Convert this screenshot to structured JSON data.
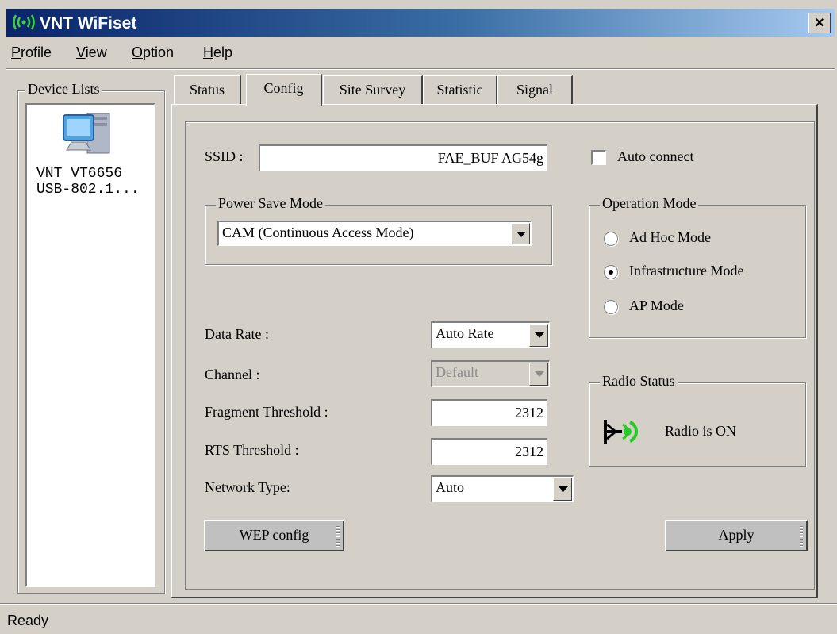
{
  "window": {
    "title": "VNT WiFiset",
    "close_glyph": "×"
  },
  "menu": {
    "items": [
      {
        "first": "P",
        "rest": "rofile"
      },
      {
        "first": "V",
        "rest": "iew"
      },
      {
        "first": "O",
        "rest": "ption"
      },
      {
        "first": "H",
        "rest": "elp"
      }
    ]
  },
  "device_list": {
    "legend": "Device Lists",
    "device_line1": "VNT VT6656",
    "device_line2": "USB-802.1..."
  },
  "tabs": [
    "Status",
    "Config",
    "Site Survey",
    "Statistic",
    "Signal"
  ],
  "active_tab": "Config",
  "config": {
    "ssid_label": "SSID :",
    "ssid_value": "FAE_BUF AG54g",
    "auto_connect_label": "Auto connect",
    "auto_connect_checked": false,
    "power_save": {
      "legend": "Power Save Mode",
      "selected": "CAM (Continuous Access Mode)"
    },
    "operation_mode": {
      "legend": "Operation Mode",
      "options": [
        "Ad Hoc Mode",
        "Infrastructure Mode",
        "AP Mode"
      ],
      "selected": "Infrastructure Mode"
    },
    "data_rate": {
      "label": "Data Rate :",
      "value": "Auto Rate"
    },
    "channel": {
      "label": "Channel :",
      "value": "Default",
      "disabled": true
    },
    "fragment_threshold": {
      "label": "Fragment Threshold :",
      "value": "2312"
    },
    "rts_threshold": {
      "label": "RTS Threshold :",
      "value": "2312"
    },
    "network_type": {
      "label": "Network Type:",
      "value": "Auto"
    },
    "radio_status": {
      "legend": "Radio Status",
      "text": "Radio is ON",
      "icon": "radio-antenna-icon"
    },
    "wep_button": "WEP config",
    "apply_button": "Apply"
  },
  "status_bar": {
    "text": "Ready"
  },
  "colors": {
    "face": "#d4d0c8",
    "title_start": "#0a246a",
    "title_end": "#a6caf0",
    "radio_on": "#22cc22"
  }
}
